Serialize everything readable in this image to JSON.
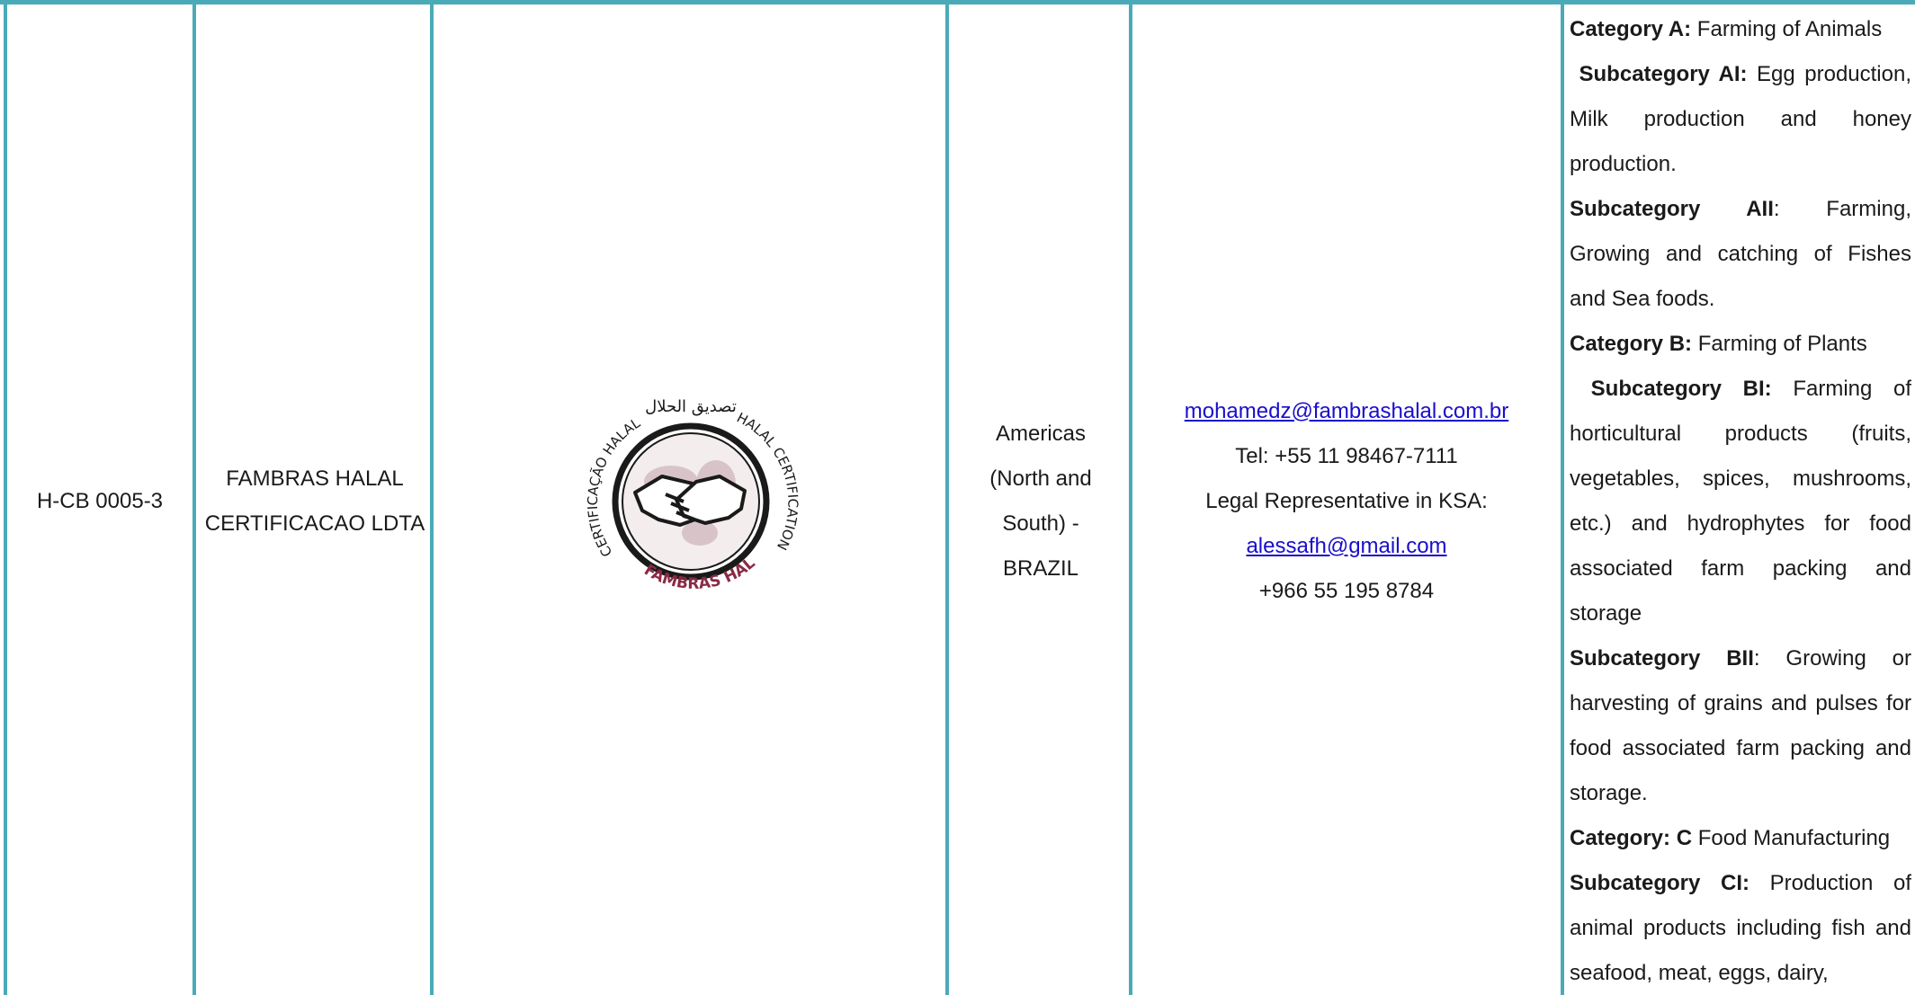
{
  "row": {
    "code": "H-CB 0005-3",
    "name_line1": "FAMBRAS HALAL",
    "name_line2": "CERTIFICACAO LDTA",
    "logo": {
      "top_text": "تصديق الحلال",
      "ring_left": "CERTIFICAÇÃO HALAL",
      "ring_right": "HALAL CERTIFICATION",
      "bottom_text": "FAMBRAS HALAL",
      "icon": "handshake-globe-icon",
      "ring_color": "#1a1a1a",
      "brand_color": "#8a2a45"
    },
    "region_lines": [
      "Americas",
      "(North and",
      "South) -",
      "BRAZIL"
    ],
    "contact": {
      "email": "mohamedz@fambrashalal.com.br",
      "tel": "Tel: +55 11 98467-7111",
      "rep_label": "Legal Representative in KSA:",
      "rep_email": "alessafh@gmail.com",
      "rep_phone": "+966 55 195 8784"
    },
    "scope": [
      {
        "bold": "Category A:",
        "text": " Farming of Animals"
      },
      {
        "bold": " Subcategory AI:",
        "text": " Egg production, Milk production and honey production."
      },
      {
        "bold": "Subcategory AII",
        "text": ": Farming, Growing and catching of Fishes and Sea foods."
      },
      {
        "bold": "Category B:",
        "text": " Farming of Plants"
      },
      {
        "bold": " Subcategory BI:",
        "text": " Farming of horticultural products (fruits, vegetables, spices, mushrooms, etc.) and hydrophytes for food associated farm packing and storage"
      },
      {
        "bold": "Subcategory BII",
        "text": ": Growing or harvesting of grains and pulses for food associated farm packing and storage."
      },
      {
        "bold": "Category: C",
        "text": " Food Manufacturing"
      },
      {
        "bold": "Subcategory CI:",
        "text": " Production of animal products including fish and seafood, meat, eggs, dairy,"
      }
    ]
  },
  "colors": {
    "border": "#4aaab8",
    "link": "#1a0dcc"
  }
}
